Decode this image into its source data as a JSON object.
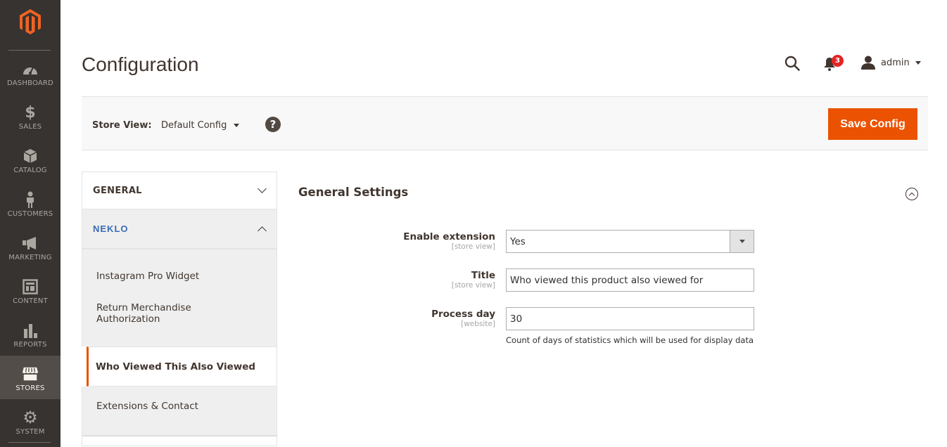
{
  "sidebar": {
    "logo": "magento-logo",
    "items": [
      {
        "label": "Dashboard",
        "icon": "dashboard-icon"
      },
      {
        "label": "Sales",
        "icon": "dollar-icon"
      },
      {
        "label": "Catalog",
        "icon": "box-icon"
      },
      {
        "label": "Customers",
        "icon": "person-icon"
      },
      {
        "label": "Marketing",
        "icon": "megaphone-icon"
      },
      {
        "label": "Content",
        "icon": "layout-icon"
      },
      {
        "label": "Reports",
        "icon": "bar-chart-icon"
      },
      {
        "label": "Stores",
        "icon": "store-icon",
        "active": true
      },
      {
        "label": "System",
        "icon": "gear-icon"
      }
    ]
  },
  "header": {
    "title": "Configuration",
    "notifications_count": "3",
    "user_name": "admin"
  },
  "store_bar": {
    "label": "Store View:",
    "selected": "Default Config",
    "help": "?",
    "save_label": "Save Config"
  },
  "config_tabs": {
    "groups": [
      {
        "title": "GENERAL",
        "expanded": false
      },
      {
        "title": "NEKLO",
        "expanded": true
      }
    ],
    "neklo_items": [
      {
        "label": "Instagram Pro Widget"
      },
      {
        "label": "Return Merchandise Authorization"
      },
      {
        "label": "Who Viewed This Also Viewed",
        "active": true
      },
      {
        "label": "Extensions & Contact"
      }
    ]
  },
  "section": {
    "title": "General Settings",
    "fields": [
      {
        "label": "Enable extension",
        "scope": "[store view]",
        "type": "select",
        "value": "Yes"
      },
      {
        "label": "Title",
        "scope": "[store view]",
        "type": "text",
        "value": "Who viewed this product also viewed for"
      },
      {
        "label": "Process day",
        "scope": "[website]",
        "type": "text",
        "value": "30",
        "note": "Count of days of statistics which will be used for display data"
      }
    ]
  },
  "colors": {
    "accent": "#eb5202",
    "sidebar_bg": "#373330",
    "sidebar_active": "#524d49",
    "badge": "#e22626",
    "neklo_brand": "#3a6bb5"
  }
}
